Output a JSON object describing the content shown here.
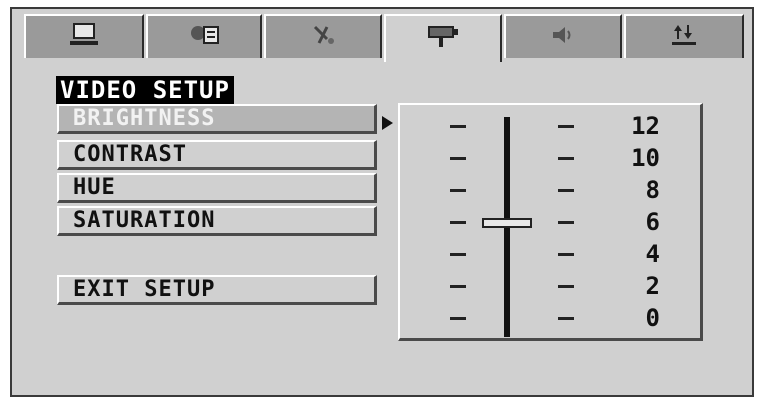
{
  "tabs": [
    {
      "icon": "monitor-icon",
      "active": false
    },
    {
      "icon": "language-icon",
      "active": false
    },
    {
      "icon": "audio-icon",
      "active": false
    },
    {
      "icon": "video-camera-icon",
      "active": true
    },
    {
      "icon": "speaker-icon",
      "active": false
    },
    {
      "icon": "preferences-icon",
      "active": false
    }
  ],
  "title": "VIDEO SETUP",
  "menu": {
    "items": [
      {
        "label": "BRIGHTNESS",
        "selected": true
      },
      {
        "label": "CONTRAST",
        "selected": false
      },
      {
        "label": "HUE",
        "selected": false
      },
      {
        "label": "SATURATION",
        "selected": false
      }
    ],
    "exit_label": "EXIT SETUP"
  },
  "scale": {
    "marks": [
      "12",
      "10",
      "8",
      "6",
      "4",
      "2",
      "0"
    ],
    "current_value": 6
  },
  "colors": {
    "panel": "#d0d0d0",
    "tab": "#9a9a9a",
    "highlight_text": "#f2f2f2"
  }
}
